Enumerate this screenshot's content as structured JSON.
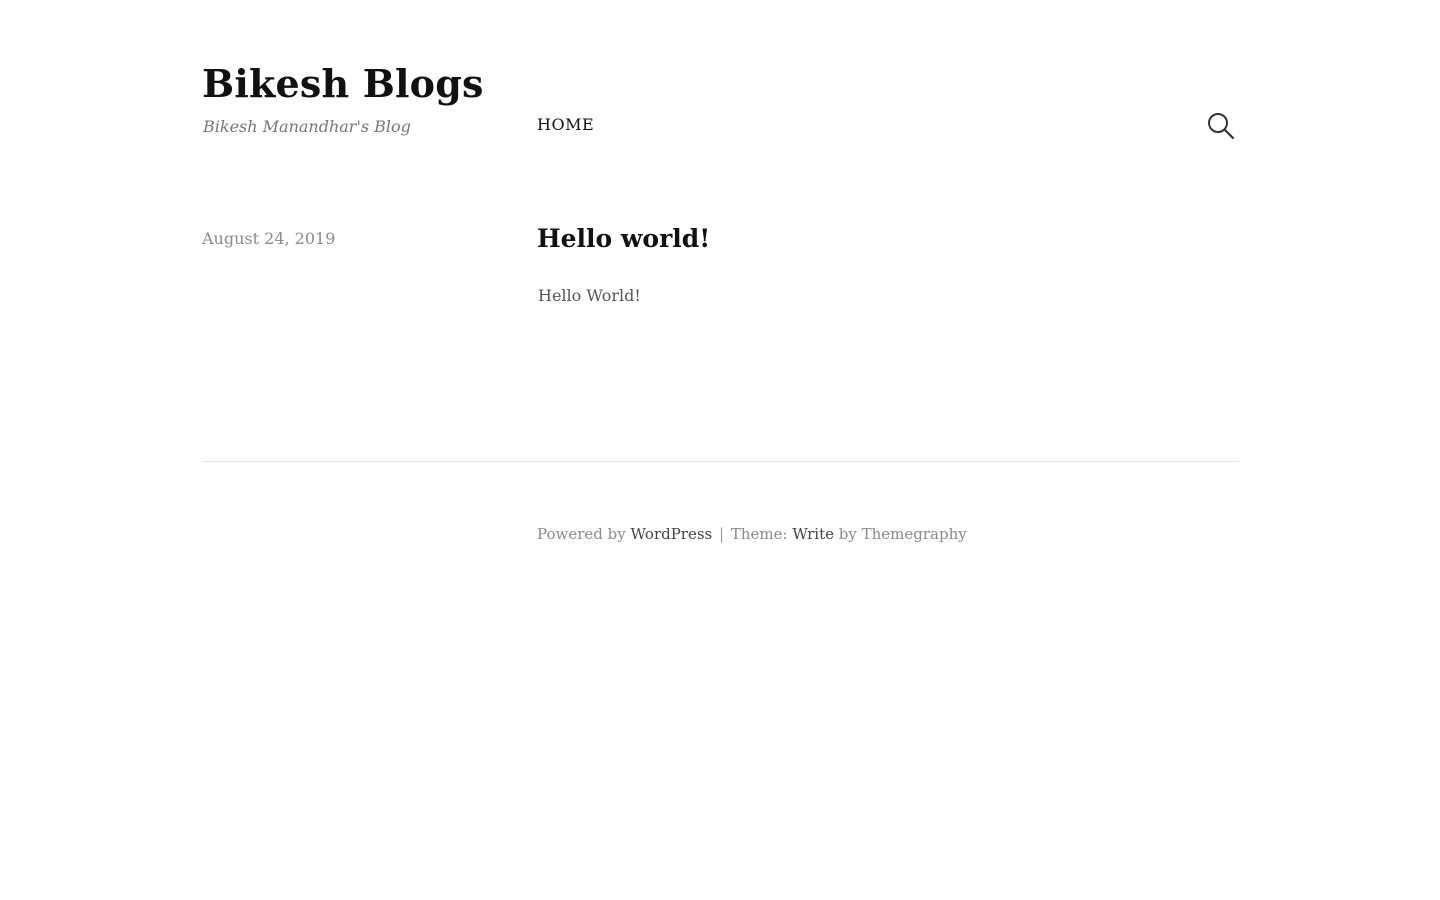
{
  "header": {
    "site_title": "Bikesh Blogs",
    "tagline": "Bikesh Manandhar's Blog",
    "nav": {
      "items": [
        {
          "label": "HOME"
        }
      ]
    },
    "search_icon": "search-icon"
  },
  "post": {
    "date": "August 24, 2019",
    "title": "Hello world!",
    "content": "Hello World!"
  },
  "footer": {
    "powered_by_text": "Powered by",
    "wordpress_link": "WordPress",
    "separator": "|",
    "theme_text": "Theme:",
    "theme_link": "Write",
    "by_text": "by Themegraphy"
  },
  "colors": {
    "background": "#ffffff",
    "title": "#111111",
    "muted": "#8a8a8a",
    "body_text": "#555555",
    "rule": "#e3e3e3"
  }
}
